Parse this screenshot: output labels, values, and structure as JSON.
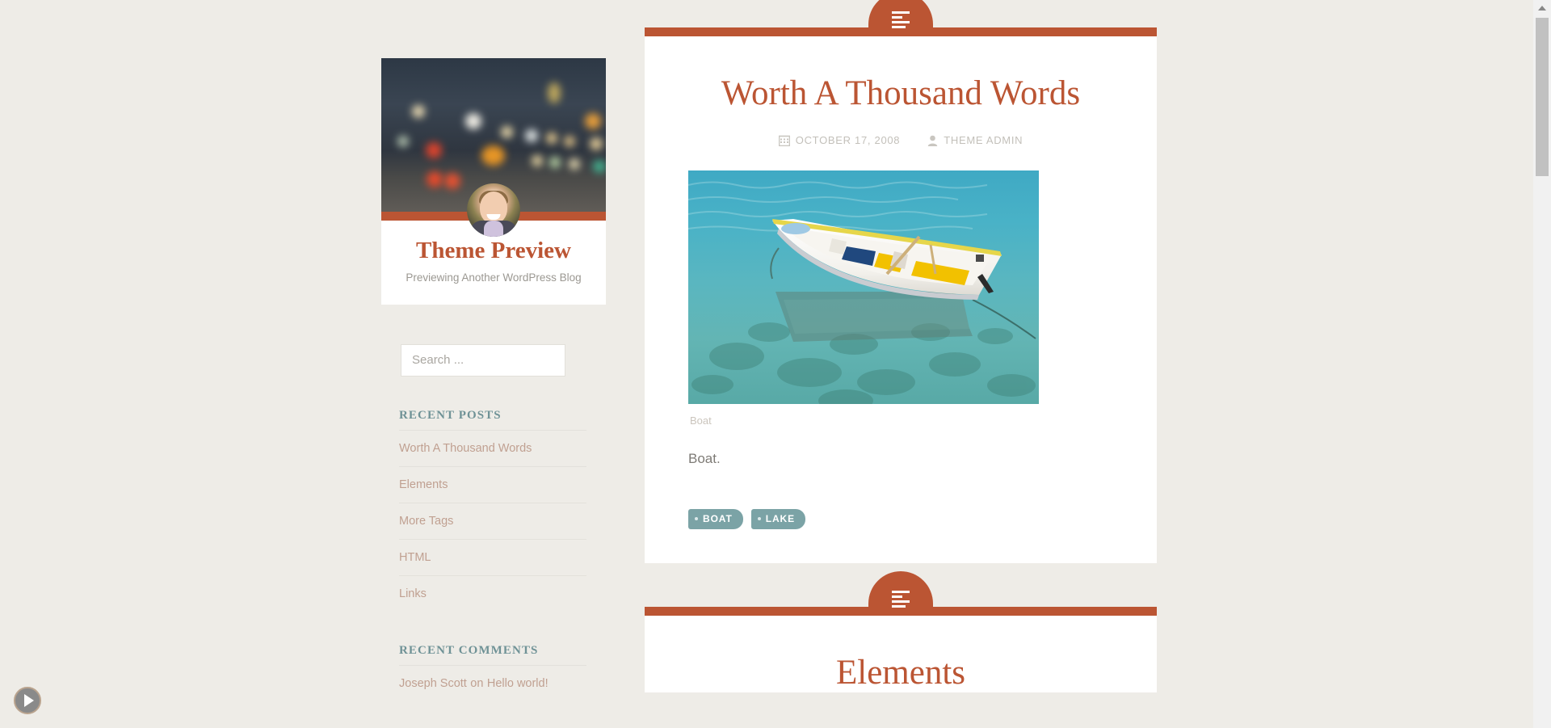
{
  "site": {
    "title": "Theme Preview",
    "description": "Previewing Another WordPress Blog",
    "accent_color": "#bb5533",
    "teal_color": "#7ba3a6",
    "background_color": "#eeece7",
    "header_image_alt": "blurred-night-street-bokeh-lights",
    "avatar_alt": "smiling-man-portrait"
  },
  "search": {
    "placeholder": "Search ...",
    "value": ""
  },
  "widgets": {
    "recent_posts": {
      "title": "Recent Posts",
      "items": [
        {
          "label": "Worth A Thousand Words"
        },
        {
          "label": "Elements"
        },
        {
          "label": "More Tags"
        },
        {
          "label": "HTML"
        },
        {
          "label": "Links"
        }
      ]
    },
    "recent_comments": {
      "title": "Recent Comments",
      "items": [
        {
          "author": "Joseph Scott",
          "connector": "on",
          "post": "Hello world!"
        }
      ]
    }
  },
  "posts": [
    {
      "format_icon": "standard-post-lines-icon",
      "title": "Worth A Thousand Words",
      "date": "October 17, 2008",
      "date_icon": "calendar-icon",
      "author": "Theme Admin",
      "author_icon": "user-icon",
      "image_alt": "white-rowboat-floating-on-clear-turquoise-water",
      "caption": "Boat",
      "body": "Boat.",
      "tags": [
        {
          "label": "Boat"
        },
        {
          "label": "Lake"
        }
      ]
    },
    {
      "format_icon": "standard-post-lines-icon",
      "title": "Elements"
    }
  ],
  "chrome": {
    "play_button": "play-icon",
    "scrollbar": "vertical-scrollbar"
  }
}
